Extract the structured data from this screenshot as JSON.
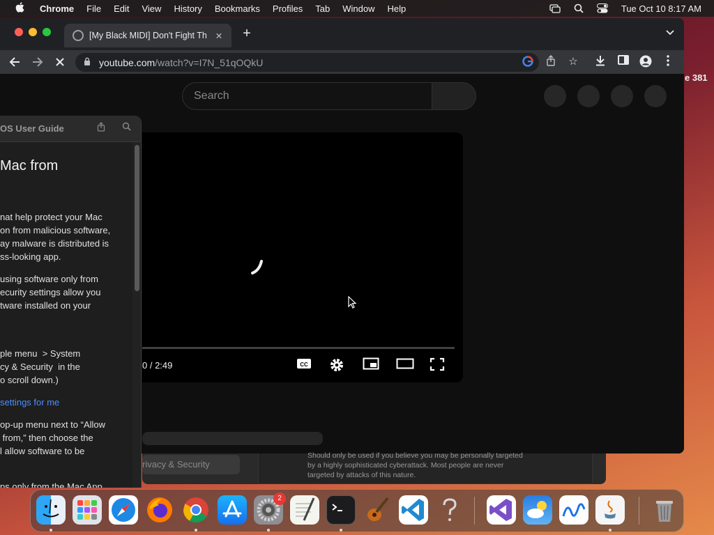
{
  "menubar": {
    "app": "Chrome",
    "items": [
      "File",
      "Edit",
      "View",
      "History",
      "Bookmarks",
      "Profiles",
      "Tab",
      "Window",
      "Help"
    ],
    "clock": "Tue Oct 10  8:17 AM"
  },
  "browser": {
    "tab_title": "[My Black MIDI] Don't Fight Th",
    "url_host": "youtube.com",
    "url_path": "/watch?v=I7N_51qOQkU"
  },
  "youtube": {
    "search_placeholder": "Search",
    "timecode": "0 / 2:49"
  },
  "guide": {
    "title": "OS User Guide",
    "heading": "Mac from",
    "para1": "nat help protect your Mac\non from malicious software,\nay malware is distributed is\nss-looking app.",
    "para2": "using software only from\necurity settings allow you\ntware installed on your",
    "para3": "ple menu  > System\ncy & Security  in the\no scroll down.)",
    "link": "settings for me",
    "para4": "op-up menu next to “Allow\n from,” then choose the\nl allow software to be",
    "para5": "ps only from the Mac App"
  },
  "behind": {
    "sidebar_selected": "rivacy & Security",
    "panel_text": "Should only be used if you believe you may be personally targeted by a highly sophisticated cyberattack. Most people are never targeted by attacks of this nature."
  },
  "side_label": "e 381",
  "dock": {
    "settings_badge": "2",
    "apps": [
      "finder",
      "launchpad",
      "safari",
      "firefox",
      "chrome",
      "app-store",
      "system-settings",
      "textedit",
      "terminal",
      "garageband",
      "vscode",
      "help",
      "visual-studio",
      "weather",
      "freeform",
      "java",
      "trash"
    ]
  }
}
